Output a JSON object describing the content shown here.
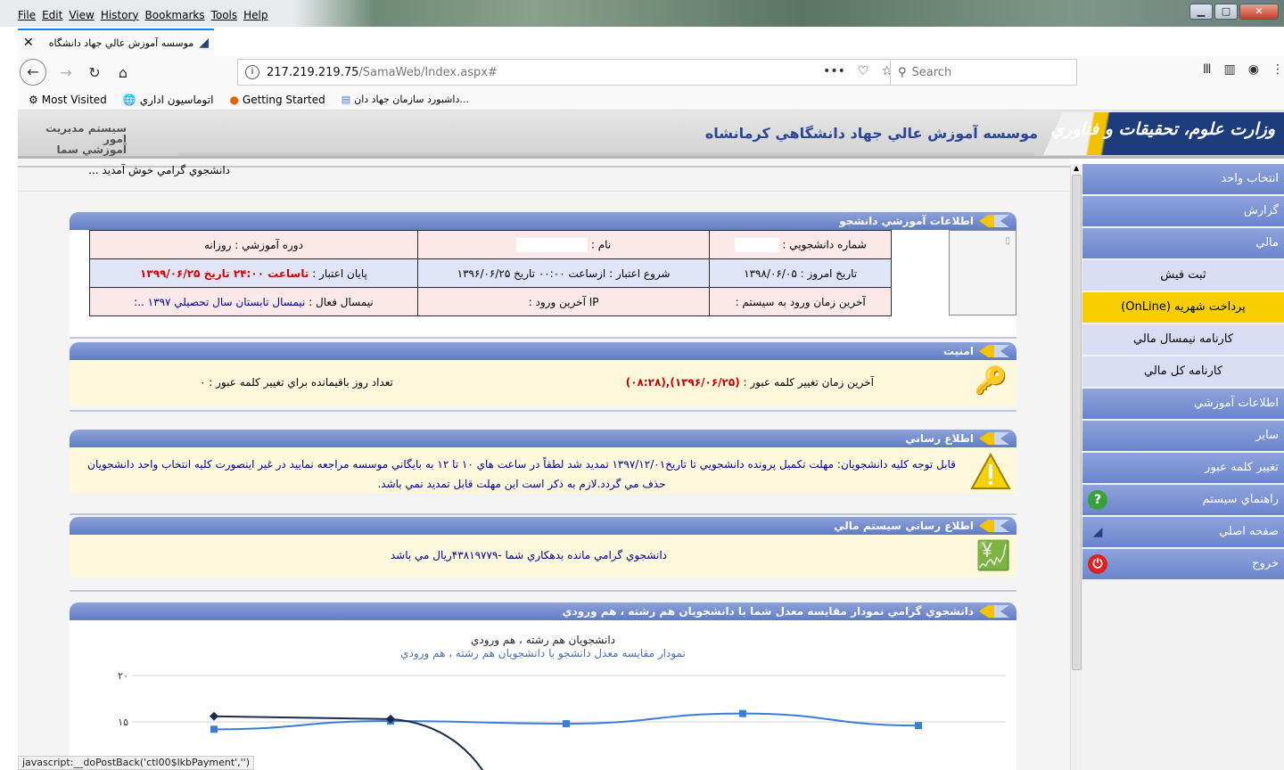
{
  "menu": [
    "File",
    "Edit",
    "View",
    "History",
    "Bookmarks",
    "Tools",
    "Help"
  ],
  "tab": {
    "title": "موسسه آموزش عالي جهاد دانشگاه",
    "close": "✕",
    "new": "+"
  },
  "url": {
    "host": "217.219.219.75",
    "path": "/SamaWeb/Index.aspx#"
  },
  "search_placeholder": "Search",
  "bookmarks": [
    "Most Visited",
    "اتوماسيون اداري",
    "Getting Started",
    "داشبورد سازمان جهاد دان..."
  ],
  "header": {
    "brand": "وزارت علوم، تحقيقات و فناوري",
    "institution": "موسسه آموزش عالي جهاد دانشگاهي كرمانشاه",
    "sama_line1": "سيستم مديريت امور",
    "sama_line2": "آموزشي سما"
  },
  "welcome": "دانشجوي گرامي خوش آمديد ...",
  "student": {
    "title": "اطلاعات آموزشي دانشجو",
    "sid_label": "شماره دانشجويي :",
    "name_label": "نام :",
    "course_label": "دوره آموزشي : روزانه",
    "today_label": "تاريخ امروز : ۱۳۹۸/۰۶/۰۵",
    "start_label": "شروع اعتبار : ازساعت ۰۰:۰۰ تاريخ ۱۳۹۶/۰۶/۲۵",
    "end_label": "پايان اعتبار :",
    "end_value": "تاساعت ۲۴:۰۰ تاريخ ۱۳۹۹/۰۶/۲۵",
    "lastlogin_label": "آخرين زمان ورود به سيستم :",
    "lastip_label": "IP آخرين ورود :",
    "semester_label": "نيمسال فعال :",
    "semester_value": "نيمسال تابستان سال تحصيلي ۱۳۹۷ ..:"
  },
  "security": {
    "title": "امنيت",
    "last_change_label": "آخرين زمان تغيير كلمه عبور :",
    "last_change_value": "(۱۳۹۶/۰۶/۲۵),(۰۸:۲۸)",
    "days_left": "تعداد روز باقيمانده براي تغيير كلمه عبور : ۰"
  },
  "notice": {
    "title": "اطلاع رساني",
    "text": "قابل توجه كليه دانشجويان: مهلت تكميل پرونده دانشجويي تا تاريخ۱۳۹۷/۱۲/۰۱ تمديد شد لطفاً در ساعت هاي ۱۰ تا ۱۲ به بايگاني موسسه مراجعه نماييد در غير اينصورت كليه انتخاب واحد دانشجويان حذف مي گردد.لازم به ذكر است اين مهلت قابل تمديد نمي باشد."
  },
  "finance": {
    "title": "اطلاع رساني سيستم مالي",
    "text": "دانشجوي گرامي مانده بدهكاري شما -۴۳۸۱۹۷۷۹ريال مي باشد"
  },
  "chart_panel": {
    "title": "دانشجوي گرامي نمودار مقايسه معدل شما با دانشجويان هم رشته ، هم ورودي"
  },
  "chart_data": {
    "type": "line",
    "title": "دانشجويان هم رشته ، هم ورودي",
    "subtitle": "نمودار مقايسه معدل دانشجو با دانشجويان هم رشته ، هم ورودي",
    "y_ticks": [
      "۲۰",
      "۱۵"
    ],
    "ylim": [
      0,
      20
    ],
    "series": [
      {
        "color": "#3a7fd5",
        "values": [
          14.2,
          15.1,
          14.8,
          15.9,
          14.6
        ]
      },
      {
        "color": "#1b2a4a",
        "values": [
          15.6,
          15.3,
          10.0
        ]
      }
    ]
  },
  "nav": [
    {
      "label": "انتخاب واحد",
      "kind": "main"
    },
    {
      "label": "گزارش",
      "kind": "main"
    },
    {
      "label": "مالي",
      "kind": "main"
    },
    {
      "label": "ثبت فيش",
      "kind": "sub"
    },
    {
      "label": "پرداخت شهريه (OnLine)",
      "kind": "sel"
    },
    {
      "label": "كارنامه نيمسال مالي",
      "kind": "sub"
    },
    {
      "label": "كارنامه كل مالي",
      "kind": "sub"
    },
    {
      "label": "اطلاعات آموزشي",
      "kind": "main"
    },
    {
      "label": "ساير",
      "kind": "main"
    },
    {
      "label": "تغيير كلمه عبور",
      "kind": "main"
    },
    {
      "label": "راهنماي سيستم",
      "kind": "main"
    },
    {
      "label": "صفحه اصلي",
      "kind": "main"
    },
    {
      "label": "خروج",
      "kind": "main"
    }
  ],
  "status": "javascript:__doPostBack('ctl00$lkbPayment','')"
}
